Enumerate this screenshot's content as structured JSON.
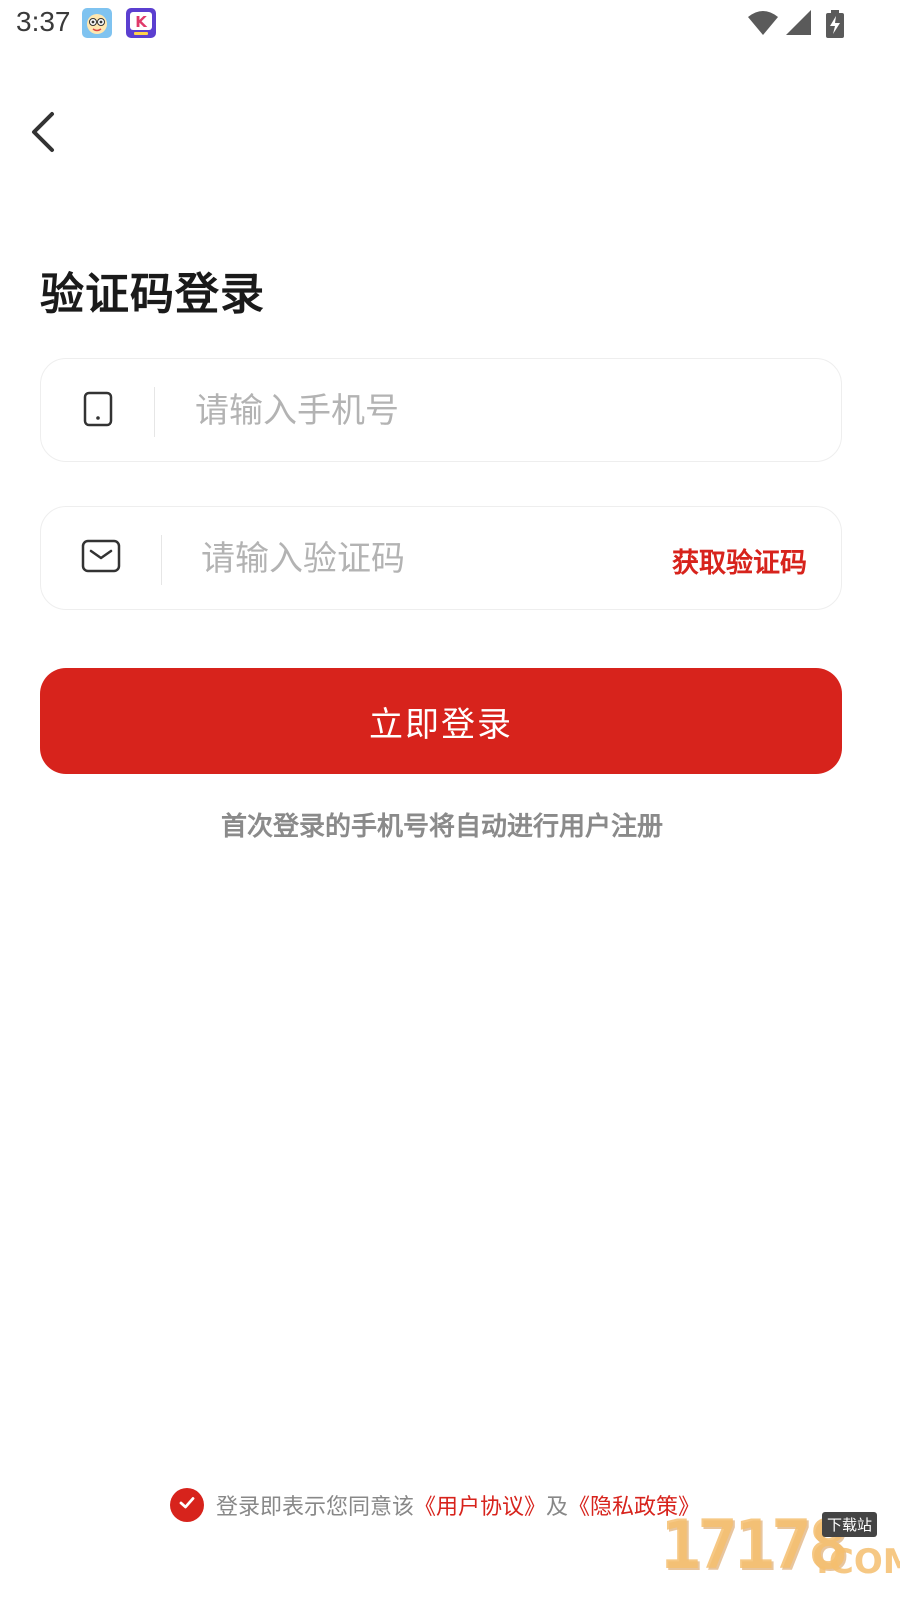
{
  "status_bar": {
    "time": "3:37",
    "notification_icons": [
      "character-app-icon",
      "k-app-icon"
    ],
    "system_icons": [
      "wifi-icon",
      "signal-icon",
      "battery-charging-icon"
    ]
  },
  "header": {
    "back_icon": "chevron-left-icon"
  },
  "title": "验证码登录",
  "phone_field": {
    "icon": "phone-icon",
    "placeholder": "请输入手机号",
    "value": ""
  },
  "code_field": {
    "icon": "envelope-icon",
    "placeholder": "请输入验证码",
    "value": "",
    "get_code_label": "获取验证码"
  },
  "login_button": {
    "label": "立即登录"
  },
  "hint": "首次登录的手机号将自动进行用户注册",
  "agreement": {
    "checked": true,
    "check_icon": "check-circle-icon",
    "prefix": "登录即表示您同意该",
    "user_agreement": "《用户协议》",
    "conjunction": "及",
    "privacy_policy": "《隐私政策》"
  },
  "watermark": {
    "digits": "17178",
    "suffix": ".COM",
    "tag": "下载站"
  },
  "colors": {
    "accent": "#d7231c",
    "title_text": "#1a1a1a",
    "placeholder": "#b3b3b3",
    "hint_text": "#8a8a8a",
    "border": "#eeeeee"
  }
}
